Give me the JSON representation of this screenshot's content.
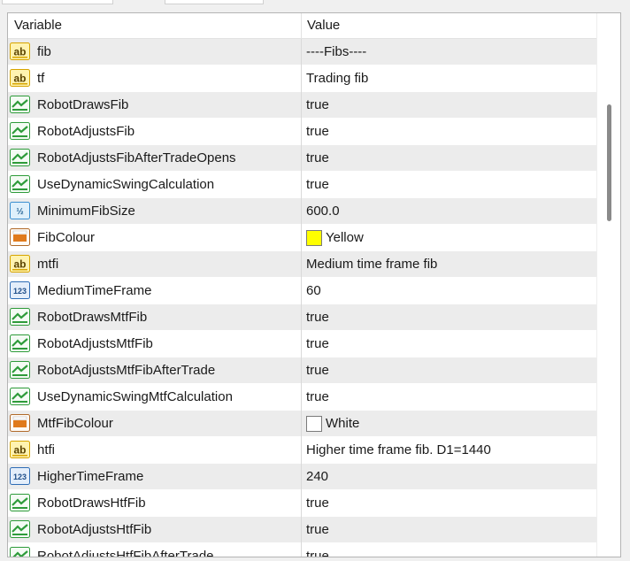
{
  "columns": {
    "variable": "Variable",
    "value": "Value"
  },
  "colors": {
    "bool_icon": "#2e9b3a",
    "string_icon": "#d6a400",
    "double_icon": "#3a8fd0",
    "int_icon": "#2f6db5",
    "color_icon": "#e07a1c"
  },
  "rows": [
    {
      "icon": "string-icon",
      "name": "fib",
      "value": "----Fibs----"
    },
    {
      "icon": "string-icon",
      "name": "tf",
      "value": "Trading fib"
    },
    {
      "icon": "bool-icon",
      "name": "RobotDrawsFib",
      "value": "true"
    },
    {
      "icon": "bool-icon",
      "name": "RobotAdjustsFib",
      "value": "true"
    },
    {
      "icon": "bool-icon",
      "name": "RobotAdjustsFibAfterTradeOpens",
      "value": "true"
    },
    {
      "icon": "bool-icon",
      "name": "UseDynamicSwingCalculation",
      "value": "true"
    },
    {
      "icon": "double-icon",
      "name": "MinimumFibSize",
      "value": "600.0"
    },
    {
      "icon": "color-icon",
      "name": "FibColour",
      "value": "Yellow",
      "swatch": "#ffff00"
    },
    {
      "icon": "string-icon",
      "name": "mtfi",
      "value": "Medium time frame fib"
    },
    {
      "icon": "int-icon",
      "name": "MediumTimeFrame",
      "value": "60"
    },
    {
      "icon": "bool-icon",
      "name": "RobotDrawsMtfFib",
      "value": "true"
    },
    {
      "icon": "bool-icon",
      "name": "RobotAdjustsMtfFib",
      "value": "true"
    },
    {
      "icon": "bool-icon",
      "name": "RobotAdjustsMtfFibAfterTrade",
      "value": "true"
    },
    {
      "icon": "bool-icon",
      "name": "UseDynamicSwingMtfCalculation",
      "value": "true"
    },
    {
      "icon": "color-icon",
      "name": "MtfFibColour",
      "value": "White",
      "swatch": "#ffffff"
    },
    {
      "icon": "string-icon",
      "name": "htfi",
      "value": "Higher time frame fib. D1=1440"
    },
    {
      "icon": "int-icon",
      "name": "HigherTimeFrame",
      "value": "240"
    },
    {
      "icon": "bool-icon",
      "name": "RobotDrawsHtfFib",
      "value": "true"
    },
    {
      "icon": "bool-icon",
      "name": "RobotAdjustsHtfFib",
      "value": "true"
    },
    {
      "icon": "bool-icon",
      "name": "RobotAdjustsHtfFibAfterTrade",
      "value": "true"
    }
  ]
}
